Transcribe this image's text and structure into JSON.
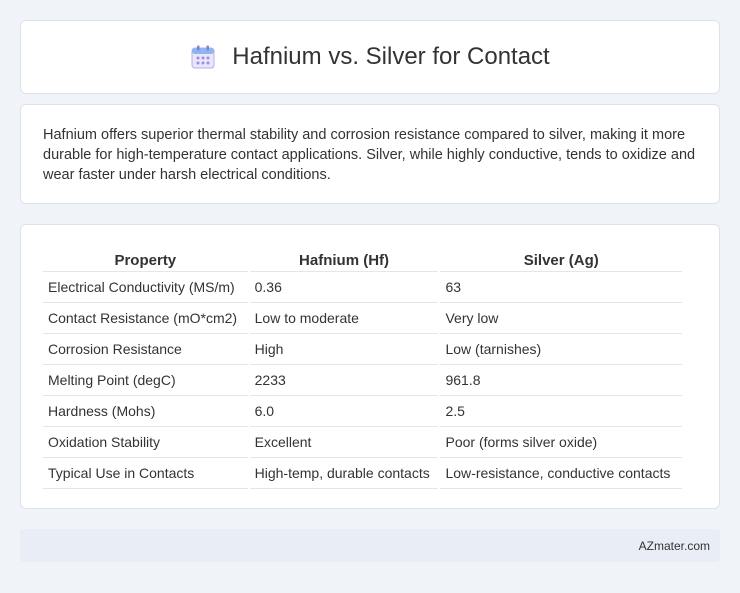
{
  "header": {
    "title": "Hafnium vs. Silver for Contact",
    "icon": "calendar-icon"
  },
  "summary": {
    "text": "Hafnium offers superior thermal stability and corrosion resistance compared to silver, making it more durable for high-temperature contact applications. Silver, while highly conductive, tends to oxidize and wear faster under harsh electrical conditions."
  },
  "table": {
    "columns": [
      "Property",
      "Hafnium (Hf)",
      "Silver (Ag)"
    ],
    "rows": [
      [
        "Electrical Conductivity (MS/m)",
        "0.36",
        "63"
      ],
      [
        "Contact Resistance (mO*cm2)",
        "Low to moderate",
        "Very low"
      ],
      [
        "Corrosion Resistance",
        "High",
        "Low (tarnishes)"
      ],
      [
        "Melting Point (degC)",
        "2233",
        "961.8"
      ],
      [
        "Hardness (Mohs)",
        "6.0",
        "2.5"
      ],
      [
        "Oxidation Stability",
        "Excellent",
        "Poor (forms silver oxide)"
      ],
      [
        "Typical Use in Contacts",
        "High-temp, durable contacts",
        "Low-resistance, conductive contacts"
      ]
    ]
  },
  "footer": {
    "site": "AZmater.com"
  },
  "colors": {
    "page_background": "#f0f3f8",
    "card_background": "#ffffff",
    "footer_background": "#e8edf6",
    "icon_accent": "#8a7fd8"
  }
}
